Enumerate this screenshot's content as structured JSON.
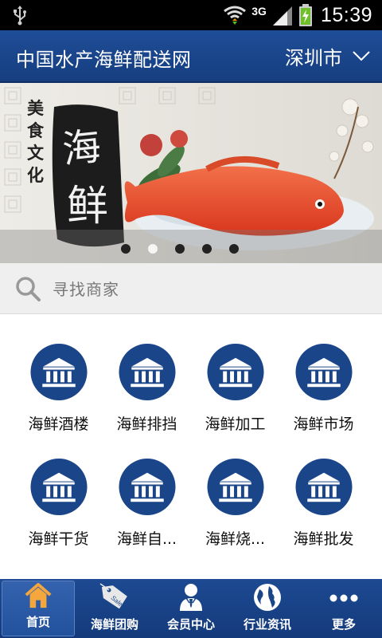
{
  "status_bar": {
    "network_type": "3G",
    "time": "15:39",
    "icons": [
      "usb-icon",
      "wifi-icon",
      "signal-icon",
      "battery-icon"
    ]
  },
  "header": {
    "title": "中国水产海鲜配送网",
    "city": "深圳市"
  },
  "banner": {
    "calligraphy_vertical": "美食文化",
    "calligraphy_big_1": "海",
    "calligraphy_big_2": "鲜",
    "slide_count": 5,
    "active_slide": 2
  },
  "search": {
    "placeholder": "寻找商家"
  },
  "categories": [
    {
      "label": "海鲜酒楼",
      "icon": "bank-building-icon"
    },
    {
      "label": "海鲜排挡",
      "icon": "bank-building-icon"
    },
    {
      "label": "海鲜加工",
      "icon": "bank-building-icon"
    },
    {
      "label": "海鲜市场",
      "icon": "bank-building-icon"
    },
    {
      "label": "海鲜干货",
      "icon": "bank-building-icon"
    },
    {
      "label": "海鲜自...",
      "icon": "bank-building-icon"
    },
    {
      "label": "海鲜烧...",
      "icon": "bank-building-icon"
    },
    {
      "label": "海鲜批发",
      "icon": "bank-building-icon"
    }
  ],
  "bottom_nav": [
    {
      "label": "首页",
      "icon": "home-icon",
      "active": true
    },
    {
      "label": "海鲜团购",
      "icon": "sale-tag-icon",
      "sale_text": "Sale"
    },
    {
      "label": "会员中心",
      "icon": "member-icon"
    },
    {
      "label": "行业资讯",
      "icon": "globe-icon"
    },
    {
      "label": "更多",
      "icon": "more-icon"
    }
  ],
  "colors": {
    "primary": "#1a4589",
    "icon_circle": "#1a4589",
    "home_icon": "#f0a23a"
  }
}
